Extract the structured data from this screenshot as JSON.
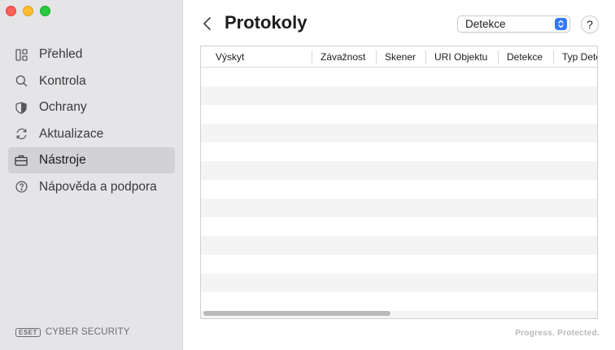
{
  "window": {
    "controls": [
      "close",
      "minimize",
      "zoom"
    ]
  },
  "sidebar": {
    "items": [
      {
        "label": "Přehled",
        "icon": "dashboard-icon",
        "active": false
      },
      {
        "label": "Kontrola",
        "icon": "search-icon",
        "active": false
      },
      {
        "label": "Ochrany",
        "icon": "shield-icon",
        "active": false
      },
      {
        "label": "Aktualizace",
        "icon": "refresh-icon",
        "active": false
      },
      {
        "label": "Nástroje",
        "icon": "briefcase-icon",
        "active": true
      },
      {
        "label": "Nápověda a podpora",
        "icon": "help-circle-icon",
        "active": false
      }
    ],
    "brand": {
      "logo": "eset",
      "product": "CYBER SECURITY"
    }
  },
  "header": {
    "title": "Protokoly",
    "log_type_select": {
      "selected": "Detekce"
    },
    "help_label": "?"
  },
  "table": {
    "columns": [
      "Výskyt",
      "Závažnost",
      "Skener",
      "URI Objektu",
      "Detekce",
      "Typ Dete"
    ],
    "rows": []
  },
  "footer": {
    "tagline": "Progress. Protected."
  },
  "colors": {
    "accent": "#3478f6",
    "sidebar_bg": "#e5e5e7",
    "active_item": "#d1d1d6"
  }
}
